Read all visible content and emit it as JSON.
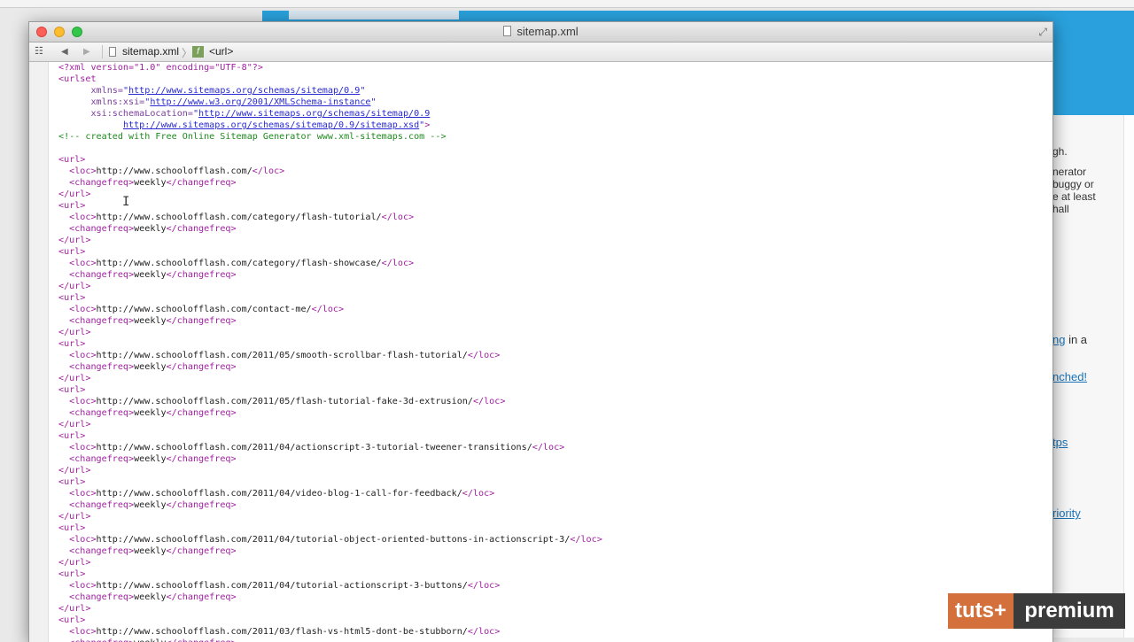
{
  "window": {
    "title": "sitemap.xml",
    "breadcrumb_file": "sitemap.xml",
    "breadcrumb_chevron": "〉",
    "breadcrumb_node": "<url>",
    "node_icon_letter": "f"
  },
  "icons": {
    "grid": "☷",
    "back": "◀",
    "forward": "▶",
    "fullscreen": "⤢",
    "cursor": "I"
  },
  "xml_header": {
    "pi": "<?xml version=\"1.0\" encoding=\"UTF-8\"?>",
    "urlset_open": "<urlset",
    "xmlns_attr": "xmlns=",
    "xmlns_value": "http://www.sitemaps.org/schemas/sitemap/0.9",
    "xsi_attr": "xmlns:xsi=",
    "xsi_value": "http://www.w3.org/2001/XMLSchema-instance",
    "schema_attr": "xsi:schemaLocation=",
    "schema_value_1": "http://www.sitemaps.org/schemas/sitemap/0.9",
    "schema_value_2": "http://www.sitemaps.org/schemas/sitemap/0.9/sitemap.xsd",
    "comment": "<!-- created with Free Online Sitemap Generator www.xml-sitemaps.com -->"
  },
  "xml_tokens": {
    "url_open": "<url>",
    "url_close": "</url>",
    "loc_open": "<loc>",
    "loc_close": "</loc>",
    "changefreq_open": "<changefreq>",
    "changefreq_close": "</changefreq>"
  },
  "entries": [
    {
      "loc": "http://www.schoolofflash.com/",
      "changefreq": "weekly"
    },
    {
      "loc": "http://www.schoolofflash.com/category/flash-tutorial/",
      "changefreq": "weekly"
    },
    {
      "loc": "http://www.schoolofflash.com/category/flash-showcase/",
      "changefreq": "weekly"
    },
    {
      "loc": "http://www.schoolofflash.com/contact-me/",
      "changefreq": "weekly"
    },
    {
      "loc": "http://www.schoolofflash.com/2011/05/smooth-scrollbar-flash-tutorial/",
      "changefreq": "weekly"
    },
    {
      "loc": "http://www.schoolofflash.com/2011/05/flash-tutorial-fake-3d-extrusion/",
      "changefreq": "weekly"
    },
    {
      "loc": "http://www.schoolofflash.com/2011/04/actionscript-3-tutorial-tweener-transitions/",
      "changefreq": "weekly"
    },
    {
      "loc": "http://www.schoolofflash.com/2011/04/video-blog-1-call-for-feedback/",
      "changefreq": "weekly"
    },
    {
      "loc": "http://www.schoolofflash.com/2011/04/tutorial-object-oriented-buttons-in-actionscript-3/",
      "changefreq": "weekly"
    },
    {
      "loc": "http://www.schoolofflash.com/2011/04/tutorial-actionscript-3-buttons/",
      "changefreq": "weekly"
    },
    {
      "loc": "http://www.schoolofflash.com/2011/03/flash-vs-html5-dont-be-stubborn/",
      "changefreq": "weekly"
    }
  ],
  "background_page": {
    "text_1": "gh.",
    "text_2": "nerator",
    "text_3": "buggy or",
    "text_4": "e at least",
    "text_5": "hall",
    "link_1_link": "ng",
    "link_1_rest": " in a",
    "link_2": "nched!",
    "link_3": "tps",
    "link_4": "riority"
  },
  "badge": {
    "left": "tuts+",
    "right": "premium"
  },
  "colors": {
    "tag": "#a0219f",
    "string": "#2a2ad0",
    "comment": "#1e8a1e",
    "background_header": "#2aa1dc",
    "badge_accent": "#d4703c"
  }
}
